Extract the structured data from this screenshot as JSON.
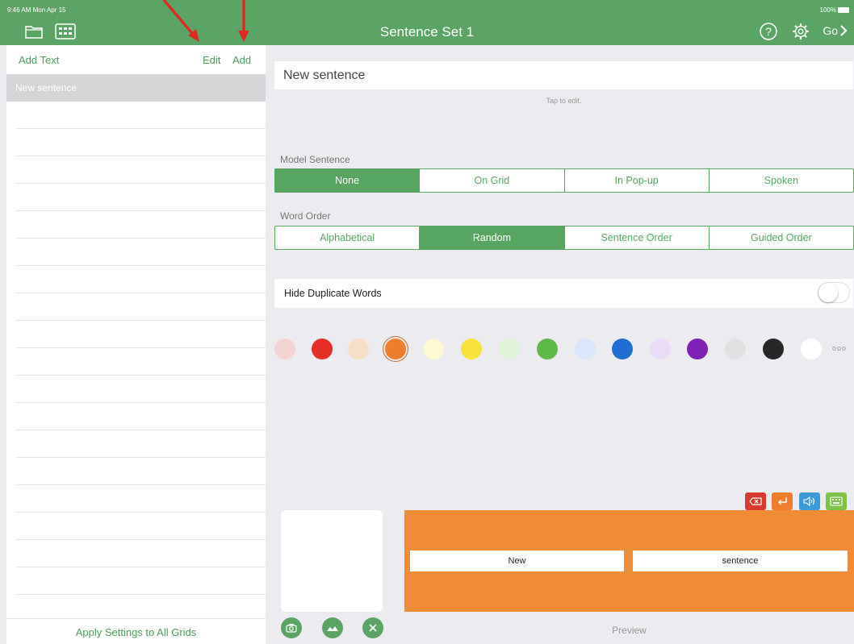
{
  "status": {
    "time": "9:46 AM  Mon Apr 15",
    "battery": "100%"
  },
  "nav": {
    "title": "Sentence Set 1",
    "go_label": "Go"
  },
  "sidebar": {
    "add_text": "Add Text",
    "edit": "Edit",
    "add": "Add",
    "items": [
      {
        "label": "New sentence",
        "selected": true
      }
    ],
    "apply_all": "Apply Settings to All Grids"
  },
  "editor": {
    "sentence_value": "New sentence",
    "tap_hint": "Tap to edit.",
    "model_sentence": {
      "label": "Model Sentence",
      "options": [
        "None",
        "On Grid",
        "In Pop-up",
        "Spoken"
      ],
      "selected": "None"
    },
    "word_order": {
      "label": "Word Order",
      "options": [
        "Alphabetical",
        "Random",
        "Sentence Order",
        "Guided Order"
      ],
      "selected": "Random"
    },
    "hide_duplicates": {
      "label": "Hide Duplicate Words",
      "on": false
    },
    "colors": [
      "#f6d3d3",
      "#e52f25",
      "#f7dfc5",
      "#ef7d2c",
      "#fdf9d2",
      "#f8e23c",
      "#def6d7",
      "#5eba46",
      "#d8e7fb",
      "#1f6ed2",
      "#eadcf8",
      "#7e22b6",
      "#e1e1e1",
      "#272727",
      "#ffffff"
    ],
    "selected_color": "#ef7d2c",
    "more_label": "ooo"
  },
  "preview": {
    "words": [
      "New",
      "sentence"
    ],
    "label": "Preview",
    "area_color": "#f08c35"
  }
}
